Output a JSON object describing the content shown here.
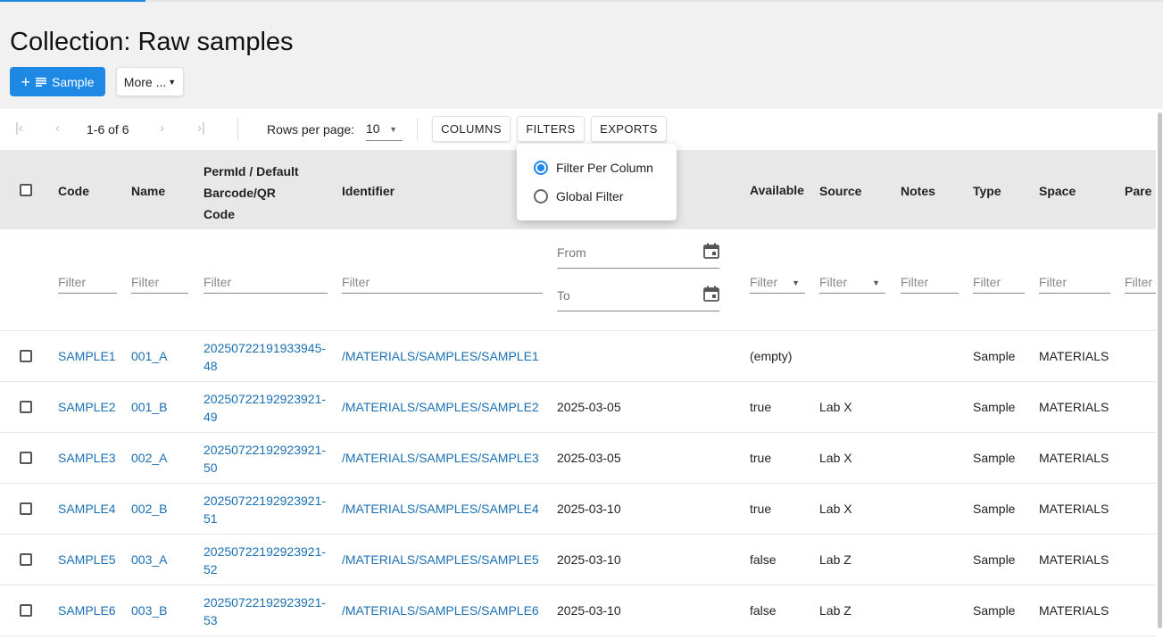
{
  "title": "Collection: Raw samples",
  "add_button": {
    "label": "Sample",
    "icon": "plus-list-icon"
  },
  "more_button": {
    "label": "More ..."
  },
  "pagination": {
    "range": "1-6 of 6",
    "rows_per_page_label": "Rows per page:",
    "rows_per_page": "10"
  },
  "toolbar": {
    "columns": "COLUMNS",
    "filters": "FILTERS",
    "exports": "EXPORTS"
  },
  "filters_menu": {
    "per_column": "Filter Per Column",
    "global": "Global Filter",
    "selected": "per_column"
  },
  "columns": {
    "code": "Code",
    "name": "Name",
    "permid_lines": [
      "PermId / Default",
      "Barcode/QR",
      "Code"
    ],
    "identifier": "Identifier",
    "available": "Available",
    "source": "Source",
    "notes": "Notes",
    "type": "Type",
    "space": "Space",
    "parents": "Pare"
  },
  "filter_placeholders": {
    "text": "Filter",
    "from": "From",
    "to": "To"
  },
  "rows": [
    {
      "code": "SAMPLE1",
      "name": "001_A",
      "permid_1": "20250722191933945-",
      "permid_2": "48",
      "identifier": "/MATERIALS/SAMPLES/SAMPLE1",
      "date": "",
      "available": "(empty)",
      "source": "",
      "type": "Sample",
      "space": "MATERIALS"
    },
    {
      "code": "SAMPLE2",
      "name": "001_B",
      "permid_1": "20250722192923921-",
      "permid_2": "49",
      "identifier": "/MATERIALS/SAMPLES/SAMPLE2",
      "date": "2025-03-05",
      "available": "true",
      "source": "Lab X",
      "type": "Sample",
      "space": "MATERIALS"
    },
    {
      "code": "SAMPLE3",
      "name": "002_A",
      "permid_1": "20250722192923921-",
      "permid_2": "50",
      "identifier": "/MATERIALS/SAMPLES/SAMPLE3",
      "date": "2025-03-05",
      "available": "true",
      "source": "Lab X",
      "type": "Sample",
      "space": "MATERIALS"
    },
    {
      "code": "SAMPLE4",
      "name": "002_B",
      "permid_1": "20250722192923921-",
      "permid_2": "51",
      "identifier": "/MATERIALS/SAMPLES/SAMPLE4",
      "date": "2025-03-10",
      "available": "true",
      "source": "Lab X",
      "type": "Sample",
      "space": "MATERIALS"
    },
    {
      "code": "SAMPLE5",
      "name": "003_A",
      "permid_1": "20250722192923921-",
      "permid_2": "52",
      "identifier": "/MATERIALS/SAMPLES/SAMPLE5",
      "date": "2025-03-10",
      "available": "false",
      "source": "Lab Z",
      "type": "Sample",
      "space": "MATERIALS"
    },
    {
      "code": "SAMPLE6",
      "name": "003_B",
      "permid_1": "20250722192923921-",
      "permid_2": "53",
      "identifier": "/MATERIALS/SAMPLES/SAMPLE6",
      "date": "2025-03-10",
      "available": "false",
      "source": "Lab Z",
      "type": "Sample",
      "space": "MATERIALS"
    }
  ],
  "colors": {
    "accent": "#1e88e5",
    "link": "#1b6fb3",
    "header_bg": "#e8e8e8",
    "page_bg": "#f1f1f1"
  }
}
